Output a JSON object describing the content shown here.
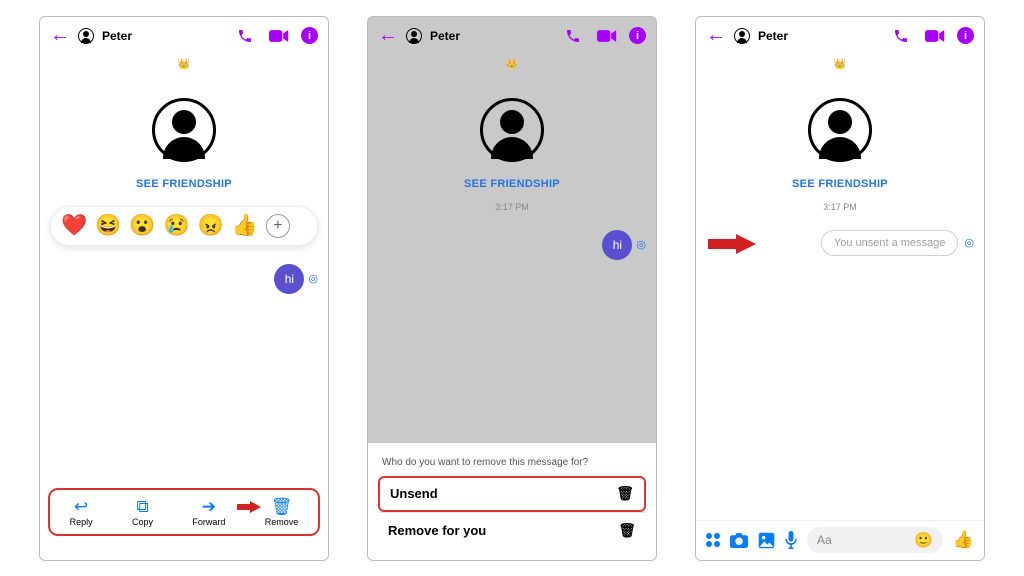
{
  "contact_name": "Peter",
  "friendship_label": "SEE FRIENDSHIP",
  "timestamp": "3:17 PM",
  "message_text": "hi",
  "reactions": [
    "❤️",
    "😆",
    "😮",
    "😢",
    "😠",
    "👍"
  ],
  "actions": {
    "reply": "Reply",
    "copy": "Copy",
    "forward": "Forward",
    "remove": "Remove"
  },
  "sheet": {
    "title": "Who do you want to remove this message for?",
    "unsend": "Unsend",
    "remove_for_you": "Remove for you"
  },
  "unsent_text": "You unsent a message",
  "composer": {
    "placeholder": "Aa"
  }
}
